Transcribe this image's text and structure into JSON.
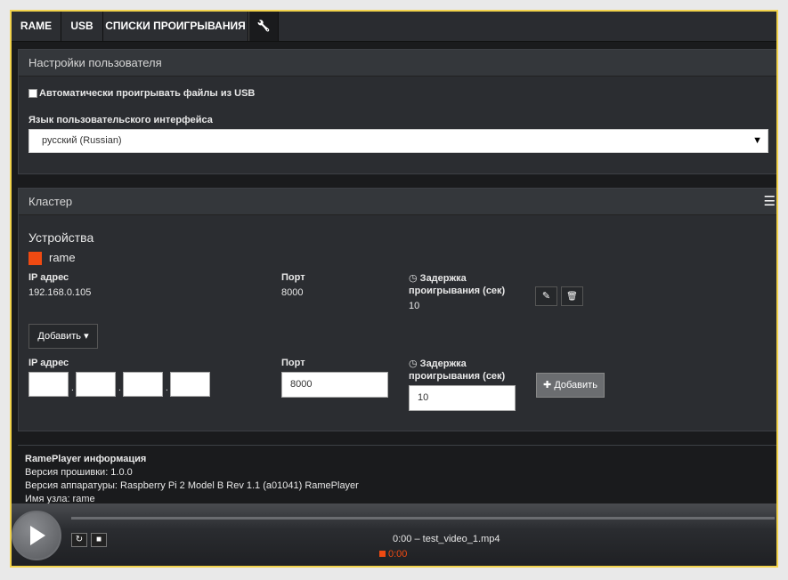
{
  "tabs": [
    {
      "label": "RAME"
    },
    {
      "label": "USB"
    },
    {
      "label": "СПИСКИ ПРОИГРЫВАНИЯ"
    },
    {
      "icon": "wrench-icon",
      "glyph": "🔧"
    }
  ],
  "user_settings": {
    "title": "Настройки пользователя",
    "autoplay_label": "Автоматически проигрывать файлы из USB",
    "autoplay_checked": false,
    "language_label": "Язык пользовательского интерфейса",
    "language_value": "русский (Russian)",
    "caret": "▼"
  },
  "cluster": {
    "title": "Кластер",
    "menu_icon": "hamburger-icon",
    "devices_title": "Устройства",
    "device_name": "rame",
    "device_color": "#f04a12",
    "ip_label": "IP адрес",
    "ip_value": "192.168.0.105",
    "port_label": "Порт",
    "port_value": "8000",
    "delay_label_line1": "Задержка",
    "delay_label_line2": "проигрывания (сек)",
    "delay_value": "10",
    "clock_glyph": "🕒",
    "edit_icon_glyph": "✎",
    "delete_icon_glyph": "🗑",
    "add_dropdown_label": "Добавить",
    "add_caret": "▾",
    "form_ip_label": "IP адрес",
    "form_ip_dot": ".",
    "form_port_label": "Порт",
    "form_port_value": "8000",
    "form_delay_line1": "Задержка",
    "form_delay_line2": "проигрывания (сек)",
    "form_delay_value": "10",
    "add_button_label": "✚ Добавить"
  },
  "info": {
    "title": "RamePlayer информация",
    "firmware": "Версия прошивки: 1.0.0",
    "hardware": "Версия аппаратуры: Raspberry Pi 2 Model B Rev 1.1 (a01041) RamePlayer",
    "hostname": "Имя узла: rame"
  },
  "player": {
    "now_playing": "0:00 – test_video_1.mp4",
    "status_time": "0:00",
    "status_color": "#f04a12",
    "refresh_glyph": "↻",
    "stop_glyph": "■"
  }
}
